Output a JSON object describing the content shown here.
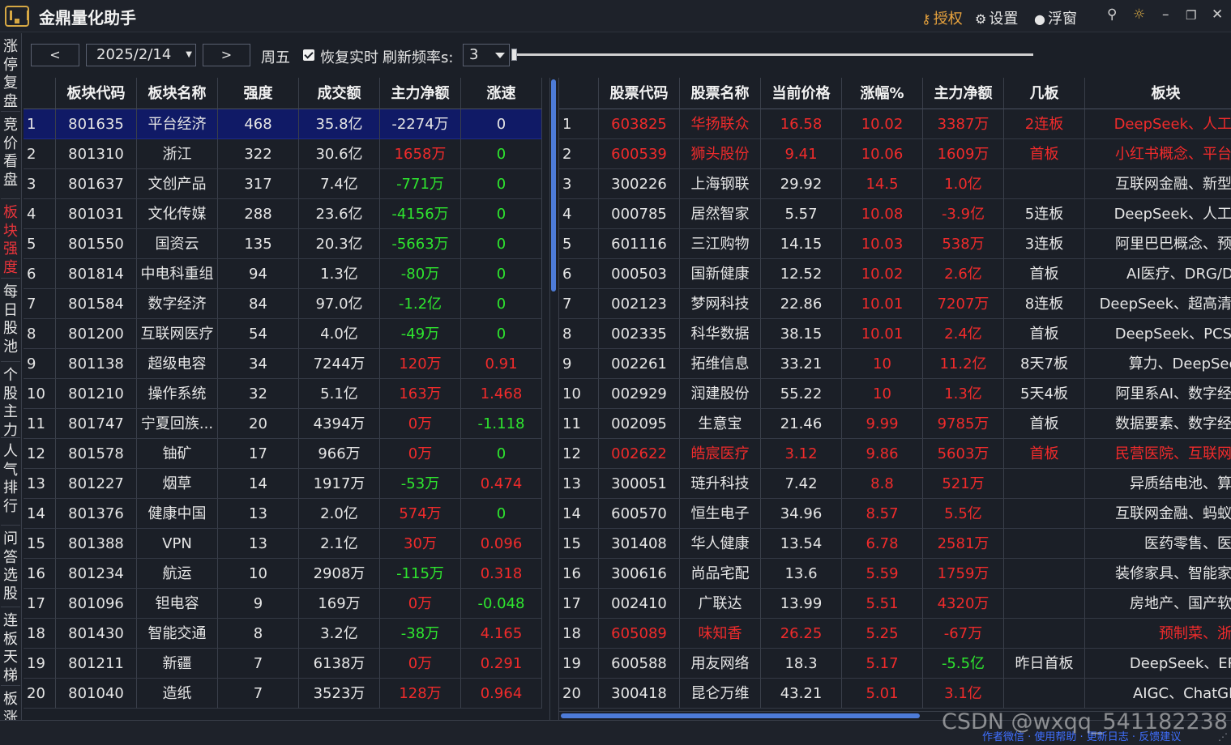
{
  "app": {
    "title": "金鼎量化助手"
  },
  "titlebar": {
    "license_label": "授权",
    "settings_label": "设置",
    "float_label": "浮窗"
  },
  "sidenav": {
    "items": [
      {
        "label": "涨停复盘",
        "active": false
      },
      {
        "label": "竞价看盘",
        "active": false
      },
      {
        "label": "板块强度",
        "active": true
      },
      {
        "label": "每日股池",
        "active": false
      },
      {
        "label": "个股主力",
        "active": false
      },
      {
        "label": "人气排行",
        "active": false
      },
      {
        "label": "问答选股",
        "active": false
      },
      {
        "label": "连板天梯",
        "active": false
      },
      {
        "label": "板涨",
        "active": false
      }
    ]
  },
  "toolbar": {
    "prev_label": "<",
    "date_value": "2025/2/14",
    "next_label": ">",
    "weekday": "周五",
    "realtime_checked": true,
    "realtime_label": "恢复实时",
    "rate_label": "刷新频率s:",
    "rate_value": "3"
  },
  "sector_table": {
    "columns": [
      "板块代码",
      "板块名称",
      "强度",
      "成交额",
      "主力净额",
      "涨速"
    ],
    "rows": [
      {
        "idx": "1",
        "code": "801635",
        "name": "平台经济",
        "strength": "468",
        "turnover": "35.8亿",
        "net": "-2274万",
        "net_color": "white",
        "speed": "0",
        "speed_color": "white",
        "selected": true
      },
      {
        "idx": "2",
        "code": "801310",
        "name": "浙江",
        "strength": "322",
        "turnover": "30.6亿",
        "net": "1658万",
        "net_color": "red",
        "speed": "0",
        "speed_color": "green"
      },
      {
        "idx": "3",
        "code": "801637",
        "name": "文创产品",
        "strength": "317",
        "turnover": "7.4亿",
        "net": "-771万",
        "net_color": "green",
        "speed": "0",
        "speed_color": "green"
      },
      {
        "idx": "4",
        "code": "801031",
        "name": "文化传媒",
        "strength": "288",
        "turnover": "23.6亿",
        "net": "-4156万",
        "net_color": "green",
        "speed": "0",
        "speed_color": "green"
      },
      {
        "idx": "5",
        "code": "801550",
        "name": "国资云",
        "strength": "135",
        "turnover": "20.3亿",
        "net": "-5663万",
        "net_color": "green",
        "speed": "0",
        "speed_color": "green"
      },
      {
        "idx": "6",
        "code": "801814",
        "name": "中电科重组",
        "strength": "94",
        "turnover": "1.3亿",
        "net": "-80万",
        "net_color": "green",
        "speed": "0",
        "speed_color": "green"
      },
      {
        "idx": "7",
        "code": "801584",
        "name": "数字经济",
        "strength": "84",
        "turnover": "97.0亿",
        "net": "-1.2亿",
        "net_color": "green",
        "speed": "0",
        "speed_color": "green"
      },
      {
        "idx": "8",
        "code": "801200",
        "name": "互联网医疗",
        "strength": "54",
        "turnover": "4.0亿",
        "net": "-49万",
        "net_color": "green",
        "speed": "0",
        "speed_color": "green"
      },
      {
        "idx": "9",
        "code": "801138",
        "name": "超级电容",
        "strength": "34",
        "turnover": "7244万",
        "net": "120万",
        "net_color": "red",
        "speed": "0.91",
        "speed_color": "red"
      },
      {
        "idx": "10",
        "code": "801210",
        "name": "操作系统",
        "strength": "32",
        "turnover": "5.1亿",
        "net": "163万",
        "net_color": "red",
        "speed": "1.468",
        "speed_color": "red"
      },
      {
        "idx": "11",
        "code": "801747",
        "name": "宁夏回族...",
        "strength": "20",
        "turnover": "4394万",
        "net": "0万",
        "net_color": "red",
        "speed": "-1.118",
        "speed_color": "green"
      },
      {
        "idx": "12",
        "code": "801578",
        "name": "铀矿",
        "strength": "17",
        "turnover": "966万",
        "net": "0万",
        "net_color": "red",
        "speed": "0",
        "speed_color": "green"
      },
      {
        "idx": "13",
        "code": "801227",
        "name": "烟草",
        "strength": "14",
        "turnover": "1917万",
        "net": "-53万",
        "net_color": "green",
        "speed": "0.474",
        "speed_color": "red"
      },
      {
        "idx": "14",
        "code": "801376",
        "name": "健康中国",
        "strength": "13",
        "turnover": "2.0亿",
        "net": "574万",
        "net_color": "red",
        "speed": "0",
        "speed_color": "green"
      },
      {
        "idx": "15",
        "code": "801388",
        "name": "VPN",
        "strength": "13",
        "turnover": "2.1亿",
        "net": "30万",
        "net_color": "red",
        "speed": "0.096",
        "speed_color": "red"
      },
      {
        "idx": "16",
        "code": "801234",
        "name": "航运",
        "strength": "10",
        "turnover": "2908万",
        "net": "-115万",
        "net_color": "green",
        "speed": "0.318",
        "speed_color": "red"
      },
      {
        "idx": "17",
        "code": "801096",
        "name": "钽电容",
        "strength": "9",
        "turnover": "169万",
        "net": "0万",
        "net_color": "red",
        "speed": "-0.048",
        "speed_color": "green"
      },
      {
        "idx": "18",
        "code": "801430",
        "name": "智能交通",
        "strength": "8",
        "turnover": "3.2亿",
        "net": "-38万",
        "net_color": "green",
        "speed": "4.165",
        "speed_color": "red"
      },
      {
        "idx": "19",
        "code": "801211",
        "name": "新疆",
        "strength": "7",
        "turnover": "6138万",
        "net": "0万",
        "net_color": "red",
        "speed": "0.291",
        "speed_color": "red"
      },
      {
        "idx": "20",
        "code": "801040",
        "name": "造纸",
        "strength": "7",
        "turnover": "3523万",
        "net": "128万",
        "net_color": "red",
        "speed": "0.964",
        "speed_color": "red"
      }
    ]
  },
  "stock_table": {
    "columns": [
      "股票代码",
      "股票名称",
      "当前价格",
      "涨幅%",
      "主力净额",
      "几板",
      "板块"
    ],
    "rows": [
      {
        "idx": "1",
        "code": "603825",
        "name": "华扬联众",
        "price": "16.58",
        "change": "10.02",
        "net": "3387万",
        "boards": "2连板",
        "sector": "DeepSeek、人工智",
        "row_color": "red"
      },
      {
        "idx": "2",
        "code": "600539",
        "name": "狮头股份",
        "price": "9.41",
        "change": "10.06",
        "net": "1609万",
        "boards": "首板",
        "sector": "小红书概念、平台经",
        "row_color": "red"
      },
      {
        "idx": "3",
        "code": "300226",
        "name": "上海钢联",
        "price": "29.92",
        "change": "14.5",
        "net": "1.0亿",
        "boards": "",
        "sector": "互联网金融、新型工"
      },
      {
        "idx": "4",
        "code": "000785",
        "name": "居然智家",
        "price": "5.57",
        "change": "10.08",
        "net": "-3.9亿",
        "boards": "5连板",
        "sector": "DeepSeek、人工智"
      },
      {
        "idx": "5",
        "code": "601116",
        "name": "三江购物",
        "price": "14.15",
        "change": "10.03",
        "net": "538万",
        "boards": "3连板",
        "sector": "阿里巴巴概念、预制"
      },
      {
        "idx": "6",
        "code": "000503",
        "name": "国新健康",
        "price": "12.52",
        "change": "10.02",
        "net": "2.6亿",
        "boards": "首板",
        "sector": "AI医疗、DRG/DIP"
      },
      {
        "idx": "7",
        "code": "002123",
        "name": "梦网科技",
        "price": "22.86",
        "change": "10.01",
        "net": "7207万",
        "boards": "8连板",
        "sector": "DeepSeek、超高清视"
      },
      {
        "idx": "8",
        "code": "002335",
        "name": "科华数据",
        "price": "38.15",
        "change": "10.01",
        "net": "2.4亿",
        "boards": "首板",
        "sector": "DeepSeek、PCS设"
      },
      {
        "idx": "9",
        "code": "002261",
        "name": "拓维信息",
        "price": "33.21",
        "change": "10",
        "net": "11.2亿",
        "boards": "8天7板",
        "sector": "算力、DeepSeek"
      },
      {
        "idx": "10",
        "code": "002929",
        "name": "润建股份",
        "price": "55.22",
        "change": "10",
        "net": "1.3亿",
        "boards": "5天4板",
        "sector": "阿里系AI、数字经济"
      },
      {
        "idx": "11",
        "code": "002095",
        "name": "生意宝",
        "price": "21.46",
        "change": "9.99",
        "net": "9785万",
        "boards": "首板",
        "sector": "数据要素、数字经济"
      },
      {
        "idx": "12",
        "code": "002622",
        "name": "皓宸医疗",
        "price": "3.12",
        "change": "9.86",
        "net": "5603万",
        "boards": "首板",
        "sector": "民营医院、互联网金",
        "row_color": "red"
      },
      {
        "idx": "13",
        "code": "300051",
        "name": "琏升科技",
        "price": "7.42",
        "change": "8.8",
        "net": "521万",
        "boards": "",
        "sector": "异质结电池、算力"
      },
      {
        "idx": "14",
        "code": "600570",
        "name": "恒生电子",
        "price": "34.96",
        "change": "8.57",
        "net": "5.5亿",
        "boards": "",
        "sector": "互联网金融、蚂蚁金"
      },
      {
        "idx": "15",
        "code": "301408",
        "name": "华人健康",
        "price": "13.54",
        "change": "6.78",
        "net": "2581万",
        "boards": "",
        "sector": "医药零售、医药"
      },
      {
        "idx": "16",
        "code": "300616",
        "name": "尚品宅配",
        "price": "13.6",
        "change": "5.59",
        "net": "1759万",
        "boards": "",
        "sector": "装修家具、智能家居"
      },
      {
        "idx": "17",
        "code": "002410",
        "name": "广联达",
        "price": "13.99",
        "change": "5.51",
        "net": "4320万",
        "boards": "",
        "sector": "房地产、国产软件"
      },
      {
        "idx": "18",
        "code": "605089",
        "name": "味知香",
        "price": "26.25",
        "change": "5.25",
        "net": "-67万",
        "boards": "",
        "sector": "预制菜、浙江",
        "row_color": "red"
      },
      {
        "idx": "19",
        "code": "600588",
        "name": "用友网络",
        "price": "18.3",
        "change": "5.17",
        "net": "-5.5亿",
        "net_color": "green",
        "boards": "昨日首板",
        "sector": "DeepSeek、ERP"
      },
      {
        "idx": "20",
        "code": "300418",
        "name": "昆仑万维",
        "price": "43.21",
        "change": "5.01",
        "net": "3.1亿",
        "boards": "",
        "sector": "AIGC、ChatGPT"
      }
    ]
  },
  "statusbar": {
    "links": "作者微信 · 使用帮助 · 更新日志 · 反馈建议",
    "watermark": "CSDN @wxqq_541182238"
  },
  "colors": {
    "up": "#f02b2b",
    "down": "#2ee62e",
    "accent": "#e8a33d",
    "selected_row": "#101a66",
    "scroll": "#4d7bd8"
  },
  "icons": [
    "key-icon",
    "gear-icon",
    "radio-dot-icon",
    "pin-icon",
    "sun-icon",
    "minimize-icon",
    "maximize-icon",
    "close-icon"
  ]
}
